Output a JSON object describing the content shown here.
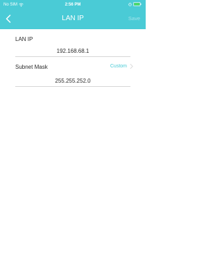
{
  "status_bar": {
    "carrier": "No SIM",
    "time": "2:56 PM"
  },
  "nav": {
    "title": "LAN IP",
    "save_label": "Save"
  },
  "form": {
    "lan_ip": {
      "label": "LAN IP",
      "value": "192.168.68.1"
    },
    "subnet_mask": {
      "label": "Subnet Mask",
      "mode": "Custom",
      "value": "255.255.252.0"
    }
  },
  "colors": {
    "accent": "#4acbd6",
    "text": "#2b2b2b",
    "divider": "#d6d6d6",
    "save_disabled": "#a4e3ea",
    "battery": "#4cd964"
  },
  "icons": {
    "wifi": "wifi-icon",
    "alarm": "alarm-icon",
    "battery": "battery-icon",
    "back": "chevron-left-icon",
    "disclosure": "chevron-right-icon"
  }
}
